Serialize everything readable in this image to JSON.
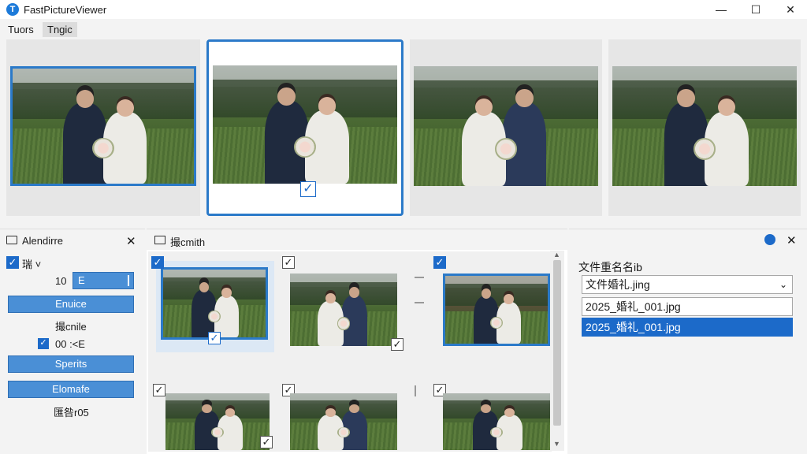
{
  "app": {
    "title": "FastPictureViewer",
    "icon_letter": "T"
  },
  "window_controls": {
    "minimize": "—",
    "maximize": "☐",
    "close": "✕"
  },
  "menu": [
    "Tuors",
    "Tngic"
  ],
  "left_panel": {
    "title": "Alendirre",
    "close": "✕",
    "checkbox1_label": "瑞 ˅",
    "number": "10",
    "field_value": "E",
    "btn1": "Enuice",
    "text1": "撮cnile",
    "checkbox2_label": "00 :<E",
    "btn2": "Sperits",
    "btn3": "Elomafe",
    "text2": "匯咎r05"
  },
  "center_panel": {
    "title": "撮cmith"
  },
  "right_panel": {
    "label": "文件重名名ib",
    "dropdown_value": "文件婚礼.jing",
    "field1": "2025_婚礼_001.jpg",
    "field2": "2025_婚礼_001.jpg",
    "close": "✕"
  },
  "icons": {
    "check": "✓",
    "folder": "folder-icon",
    "settings": "gear-icon"
  },
  "colors": {
    "accent": "#1c6ac9",
    "button": "#4a8fd6"
  }
}
